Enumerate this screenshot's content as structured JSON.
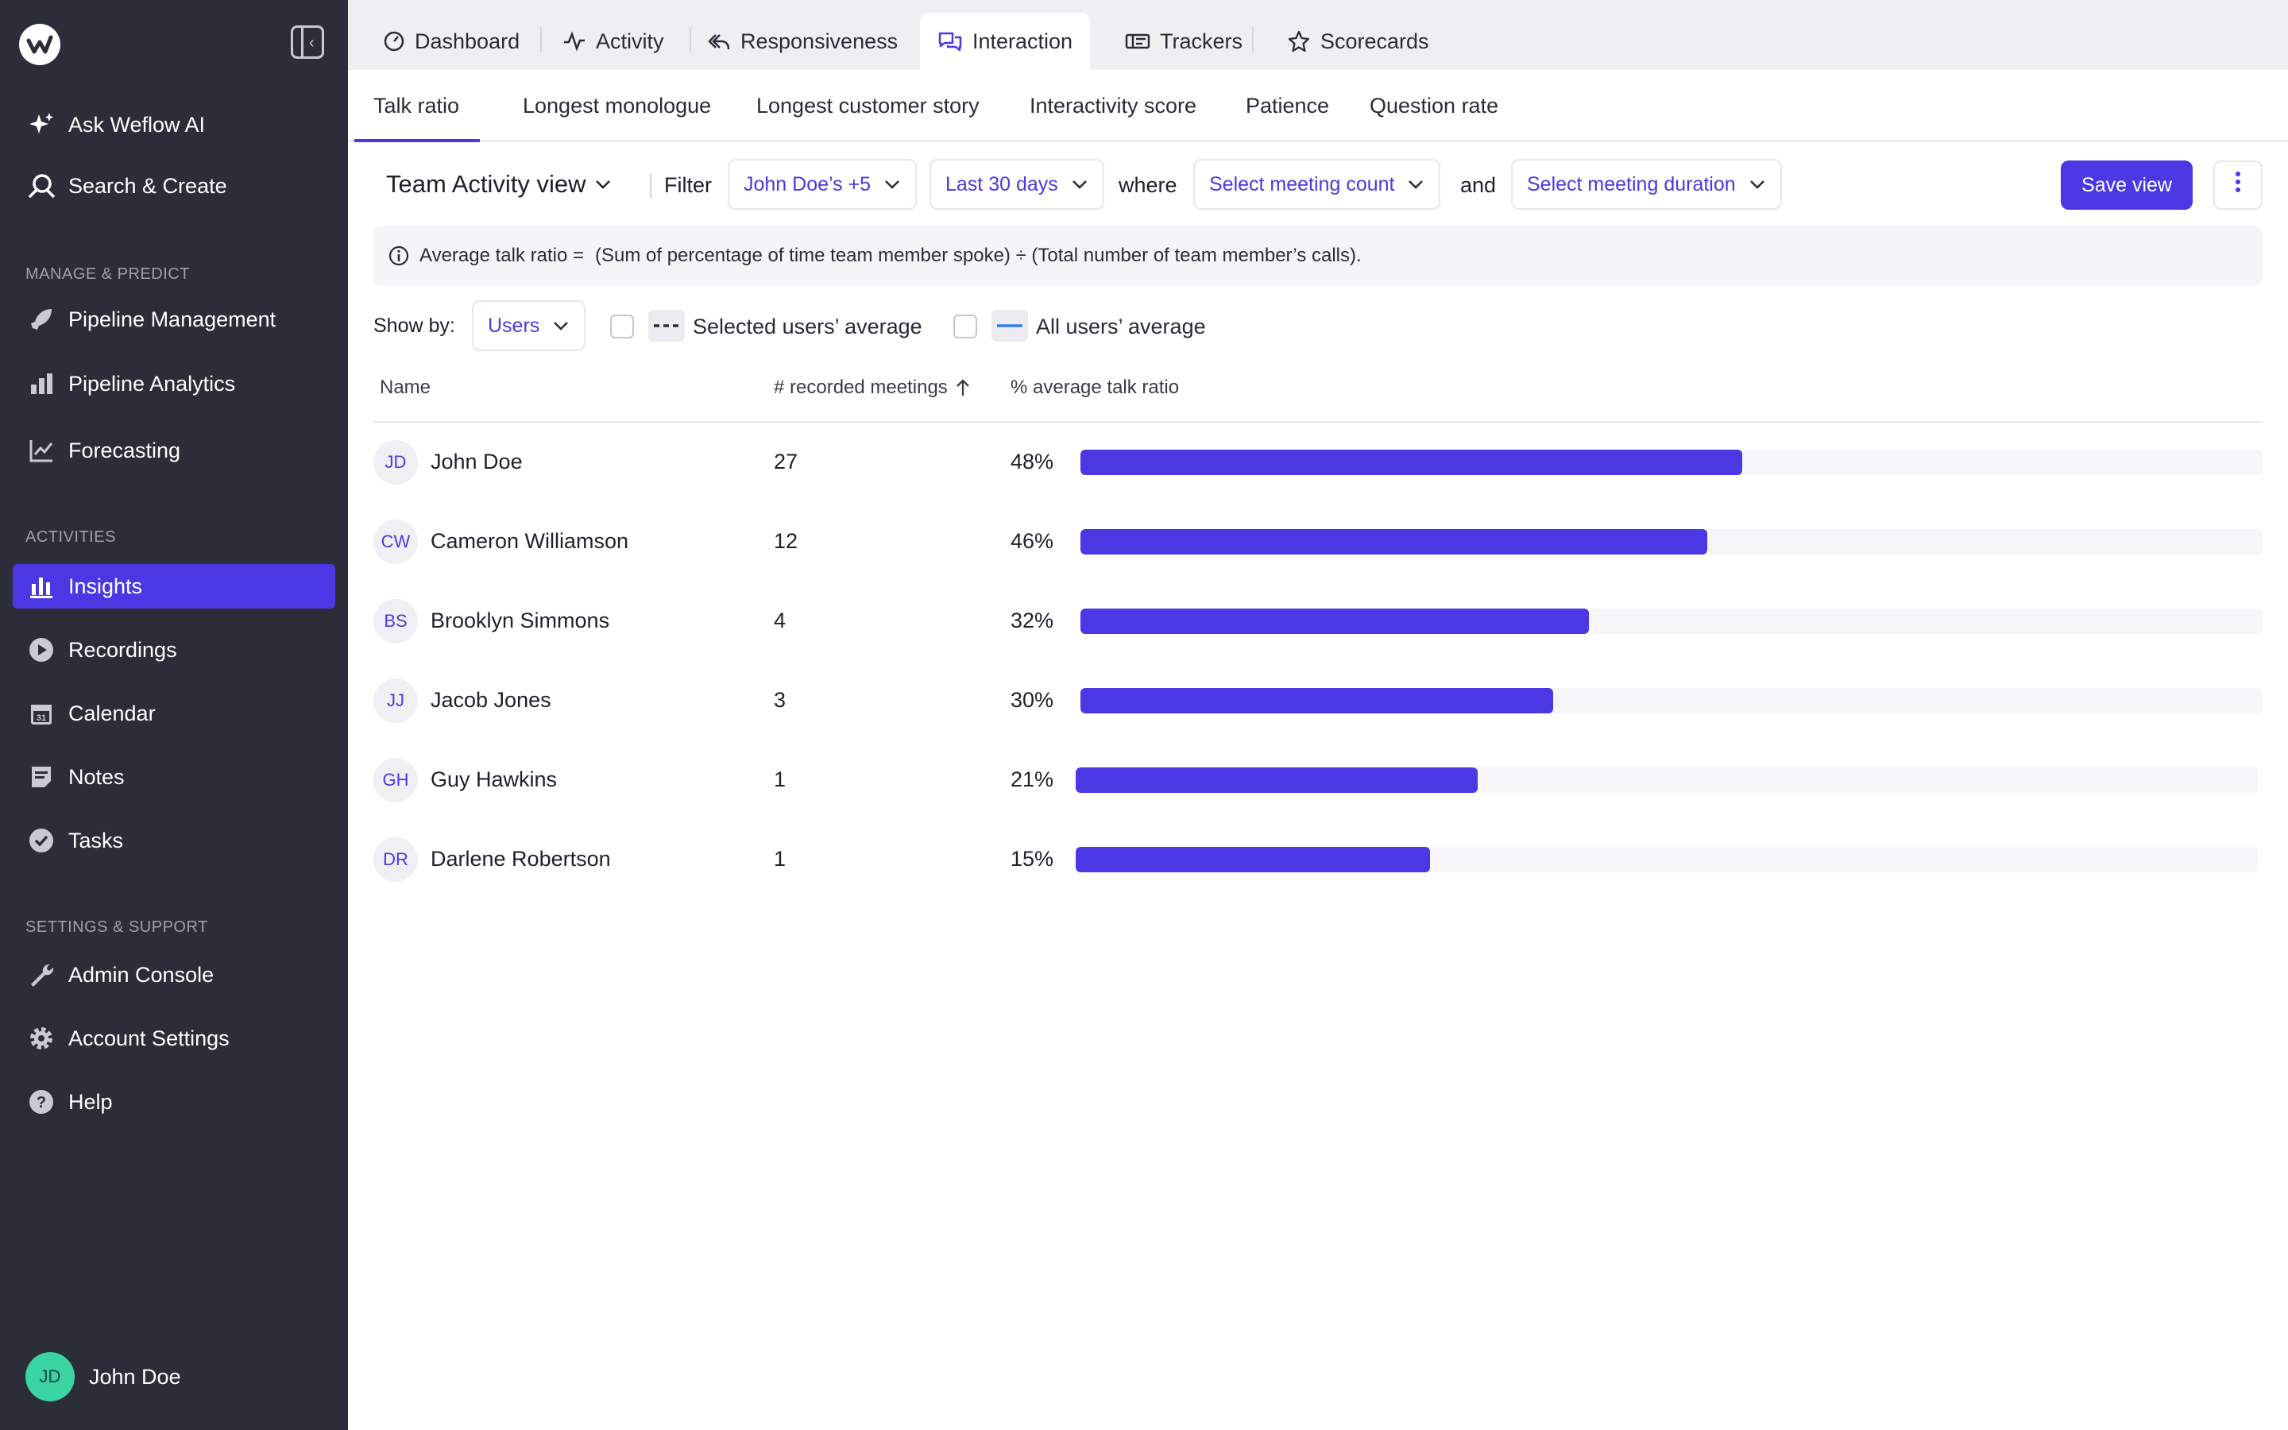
{
  "app": {
    "nav": {
      "ask_ai": "Ask Weflow AI",
      "search_create": "Search & Create",
      "section_manage": "MANAGE & PREDICT",
      "pipeline_management": "Pipeline Management",
      "pipeline_analytics": "Pipeline Analytics",
      "forecasting": "Forecasting",
      "section_activities": "ACTIVITIES",
      "insights": "Insights",
      "recordings": "Recordings",
      "calendar": "Calendar",
      "notes": "Notes",
      "tasks": "Tasks",
      "section_settings": "SETTINGS & SUPPORT",
      "admin_console": "Admin Console",
      "account_settings": "Account Settings",
      "help": "Help"
    },
    "user": {
      "initials": "JD",
      "name": "John Doe"
    }
  },
  "top_tabs": {
    "dashboard": "Dashboard",
    "activity": "Activity",
    "responsiveness": "Responsiveness",
    "interaction": "Interaction",
    "trackers": "Trackers",
    "scorecards": "Scorecards"
  },
  "sub_tabs": {
    "talk_ratio": "Talk ratio",
    "longest_monologue": "Longest monologue",
    "longest_story": "Longest customer story",
    "interactivity": "Interactivity score",
    "patience": "Patience",
    "question_rate": "Question rate"
  },
  "toolbar": {
    "view_title": "Team Activity view",
    "filter_label": "Filter",
    "users_filter": "John Doe’s +5",
    "date_filter": "Last 30 days",
    "where_label": "where",
    "meeting_count": "Select meeting count",
    "and_label": "and",
    "meeting_duration": "Select meeting duration",
    "save_view": "Save view"
  },
  "info": {
    "label": "Average talk ratio =",
    "formula": "(Sum of percentage of time team member spoke) ÷ (Total number of team member’s calls)."
  },
  "show_by": {
    "label": "Show by:",
    "value": "Users",
    "selected_avg": "Selected users’ average",
    "all_avg": "All users’ average"
  },
  "table": {
    "col_name": "Name",
    "col_meetings": "# recorded meetings",
    "col_ratio": "% average talk ratio",
    "rows": [
      {
        "initials": "JD",
        "name": "John Doe",
        "meetings": "27",
        "ratio_label": "48%",
        "ratio": 0.56
      },
      {
        "initials": "CW",
        "name": "Cameron Williamson",
        "meetings": "12",
        "ratio_label": "46%",
        "ratio": 0.53
      },
      {
        "initials": "BS",
        "name": "Brooklyn Simmons",
        "meetings": "4",
        "ratio_label": "32%",
        "ratio": 0.43
      },
      {
        "initials": "JJ",
        "name": "Jacob Jones",
        "meetings": "3",
        "ratio_label": "30%",
        "ratio": 0.4
      },
      {
        "initials": "GH",
        "name": "Guy Hawkins",
        "meetings": "1",
        "ratio_label": "21%",
        "ratio": 0.34
      },
      {
        "initials": "DR",
        "name": "Darlene Robertson",
        "meetings": "1",
        "ratio_label": "15%",
        "ratio": 0.3
      }
    ]
  },
  "colors": {
    "accent": "#4b38e4",
    "sidebar": "#2b2d38",
    "avatar_green": "#3ad3a2"
  }
}
